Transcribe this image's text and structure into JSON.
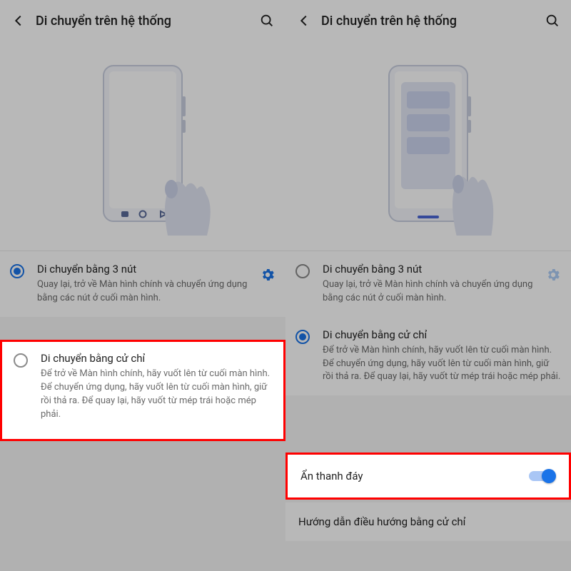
{
  "left": {
    "header": {
      "title": "Di chuyển trên hệ thống"
    },
    "options": {
      "threeButton": {
        "title": "Di chuyển bằng 3 nút",
        "desc": "Quay lại, trở về Màn hình chính và chuyển ứng dụng bằng các nút ở cuối màn hình.",
        "selected": true
      },
      "gesture": {
        "title": "Di chuyển bằng cử chỉ",
        "desc": "Để trở về Màn hình chính, hãy vuốt lên từ cuối màn hình. Để chuyển ứng dụng, hãy vuốt lên từ cuối màn hình, giữ rồi thả ra. Để quay lại, hãy vuốt từ mép trái hoặc mép phải.",
        "selected": false
      }
    }
  },
  "right": {
    "header": {
      "title": "Di chuyển trên hệ thống"
    },
    "options": {
      "threeButton": {
        "title": "Di chuyển bằng 3 nút",
        "desc": "Quay lại, trở về Màn hình chính và chuyển ứng dụng bằng các nút ở cuối màn hình.",
        "selected": false
      },
      "gesture": {
        "title": "Di chuyển bằng cử chỉ",
        "desc": "Để trở về Màn hình chính, hãy vuốt lên từ cuối màn hình. Để chuyển ứng dụng, hãy vuốt lên từ cuối màn hình, giữ rồi thả ra. Để quay lại, hãy vuốt từ mép trái hoặc mép phải.",
        "selected": true
      }
    },
    "hideBar": {
      "label": "Ẩn thanh đáy",
      "on": true
    },
    "tutorial": {
      "label": "Hướng dẫn điều hướng bằng cử chỉ"
    }
  },
  "colors": {
    "accent": "#1a73e8",
    "highlight": "#ff0000"
  }
}
